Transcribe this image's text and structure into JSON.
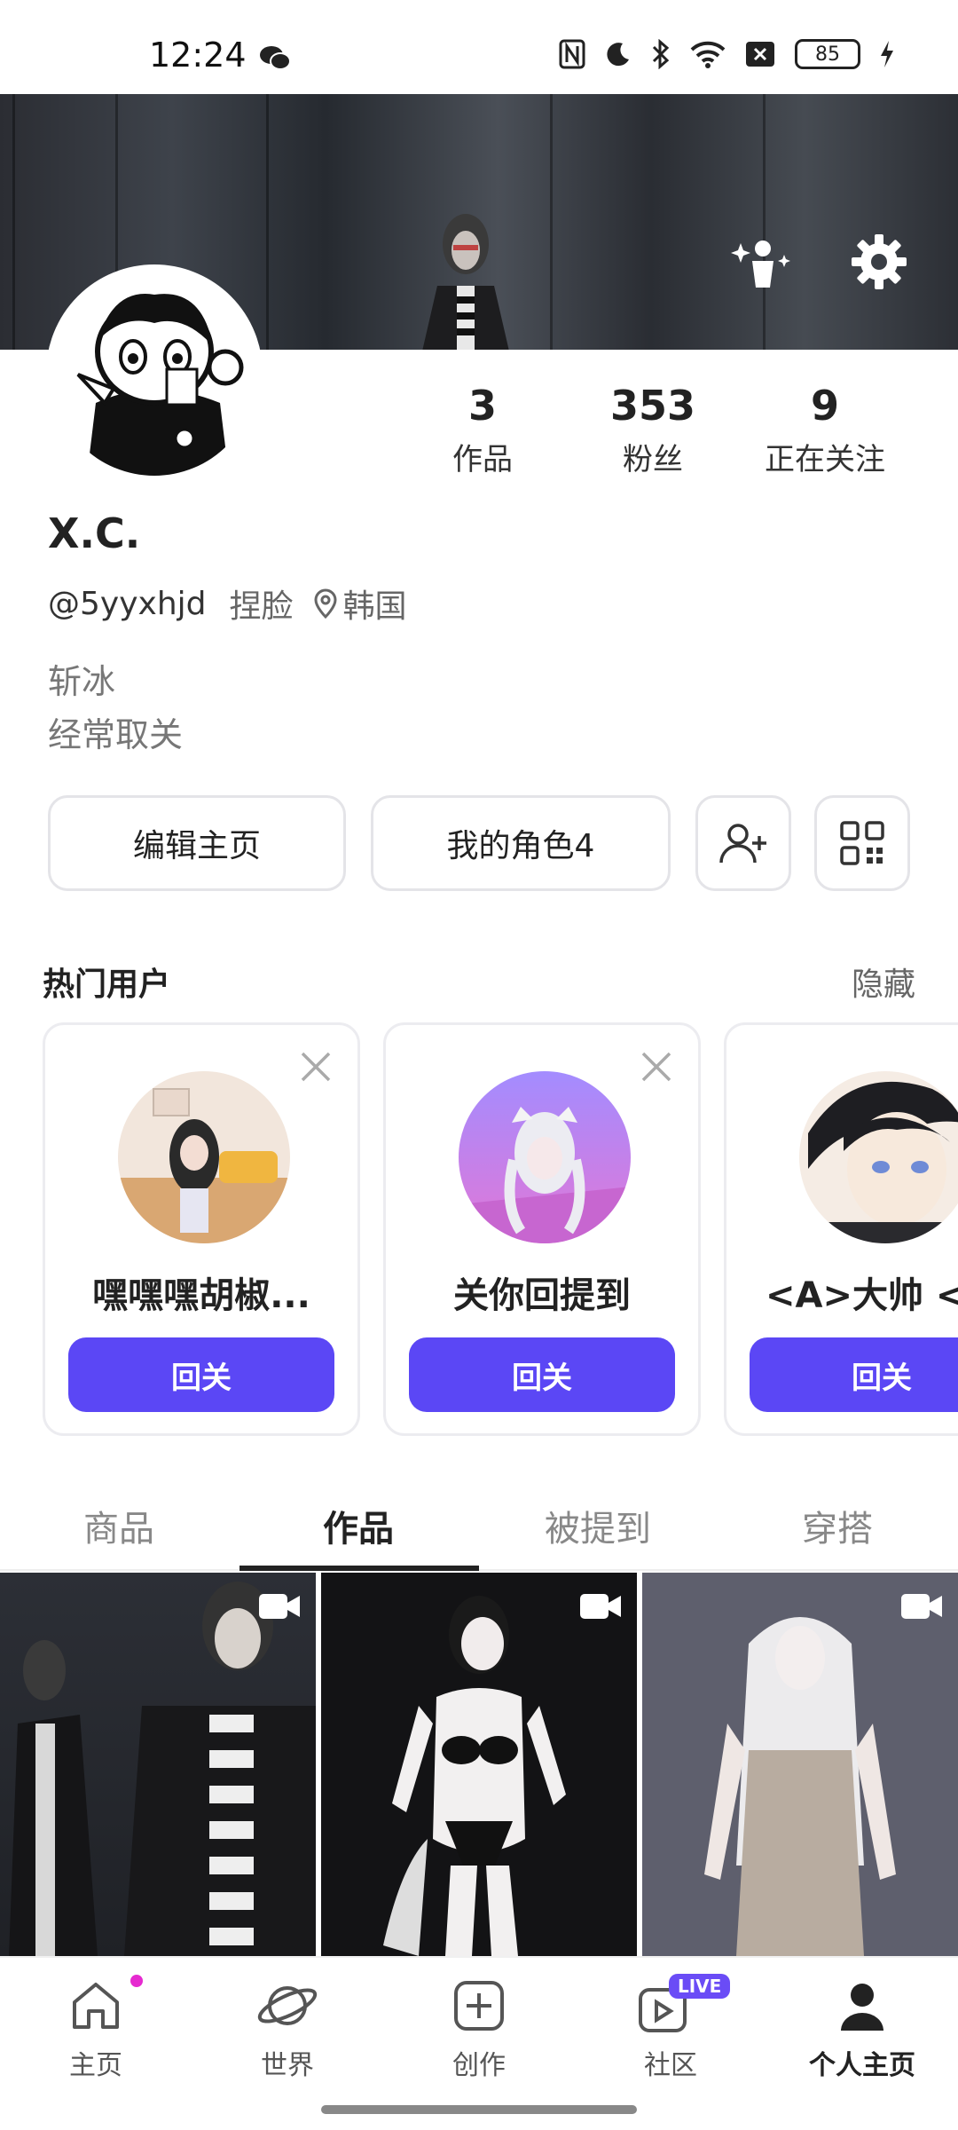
{
  "status_bar": {
    "time": "12:24",
    "battery": "85"
  },
  "profile": {
    "display_name": "X.C.",
    "handle": "@5yyxhjd",
    "tag": "捏脸",
    "location": "韩国",
    "bio_line1": "斩冰",
    "bio_line2": "经常取关"
  },
  "stats": [
    {
      "value": "3",
      "label": "作品"
    },
    {
      "value": "353",
      "label": "粉丝"
    },
    {
      "value": "9",
      "label": "正在关注"
    }
  ],
  "actions": {
    "edit_profile": "编辑主页",
    "my_characters": "我的角色4"
  },
  "popular": {
    "title": "热门用户",
    "hide": "隐藏",
    "users": [
      {
        "name": "嘿嘿嘿胡椒...",
        "button": "回关"
      },
      {
        "name": "关你回提到",
        "button": "回关"
      },
      {
        "name": "<A>大帅 </A",
        "button": "回关"
      }
    ]
  },
  "tabs": [
    "商品",
    "作品",
    "被提到",
    "穿搭"
  ],
  "bottom_nav": [
    {
      "label": "主页",
      "icon": "home-icon"
    },
    {
      "label": "世界",
      "icon": "planet-icon"
    },
    {
      "label": "创作",
      "icon": "create-plus-icon"
    },
    {
      "label": "社区",
      "icon": "community-live-icon",
      "badge": "LIVE"
    },
    {
      "label": "个人主页",
      "icon": "profile-icon"
    }
  ],
  "colors": {
    "accent": "#5b47f5",
    "notification_dot": "#e62ad0"
  }
}
